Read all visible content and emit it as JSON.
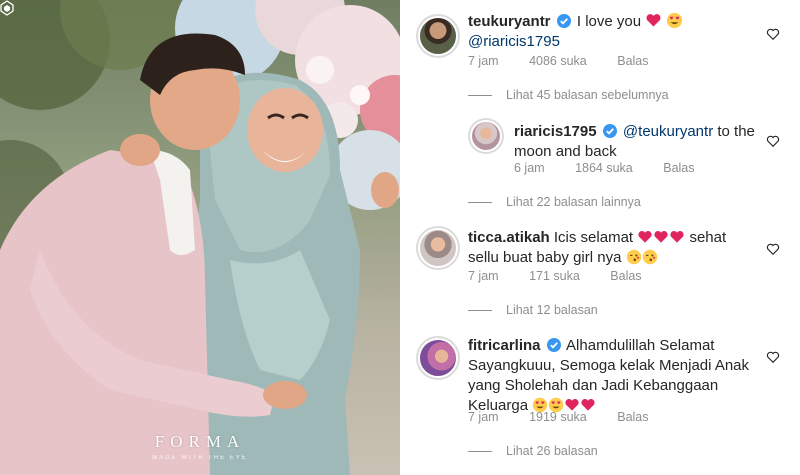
{
  "photo": {
    "watermark": "FORMA",
    "watermark_sub": "MADE WITH THE EYE"
  },
  "comments": [
    {
      "username": "teukuryantr",
      "verified": true,
      "text": "I love you",
      "emojis": [
        "red-heart",
        "heart-eyes"
      ],
      "mention_line": "@riaricis1795",
      "time": "7 jam",
      "likes": "4086 suka",
      "reply": "Balas"
    },
    {
      "username": "riaricis1795",
      "verified": true,
      "mention": "@teukuryantr",
      "text": "to the moon and back",
      "time": "6 jam",
      "likes": "1864 suka",
      "reply": "Balas"
    },
    {
      "username": "ticca.atikah",
      "verified": false,
      "text_before": "Icis selamat",
      "text_after": "sehat sellu buat baby girl nya",
      "emojis_mid": [
        "red-heart",
        "red-heart",
        "red-heart"
      ],
      "emojis_end": [
        "kiss-face",
        "kiss-face"
      ],
      "time": "7 jam",
      "likes": "171 suka",
      "reply": "Balas"
    },
    {
      "username": "fitricarlina",
      "verified": true,
      "text": "Alhamdulillah Selamat Sayangkuuu, Semoga kelak Menjadi Anak yang Sholehah dan Jadi Kebanggaan Keluarga",
      "emojis": [
        "heart-eyes",
        "heart-eyes",
        "red-heart",
        "red-heart"
      ],
      "time": "7 jam",
      "likes": "1919 suka",
      "reply": "Balas"
    }
  ],
  "view_replies": {
    "previous": "Lihat 45 balasan sebelumnya",
    "more": "Lihat 22 balasan lainnya",
    "ticca": "Lihat 12 balasan",
    "fitri": "Lihat 26 balasan"
  },
  "colors": {
    "text": "#262626",
    "muted": "#8e8e8e",
    "mention": "#00376b",
    "verified": "#3897f0",
    "heart": "#e0245e"
  }
}
